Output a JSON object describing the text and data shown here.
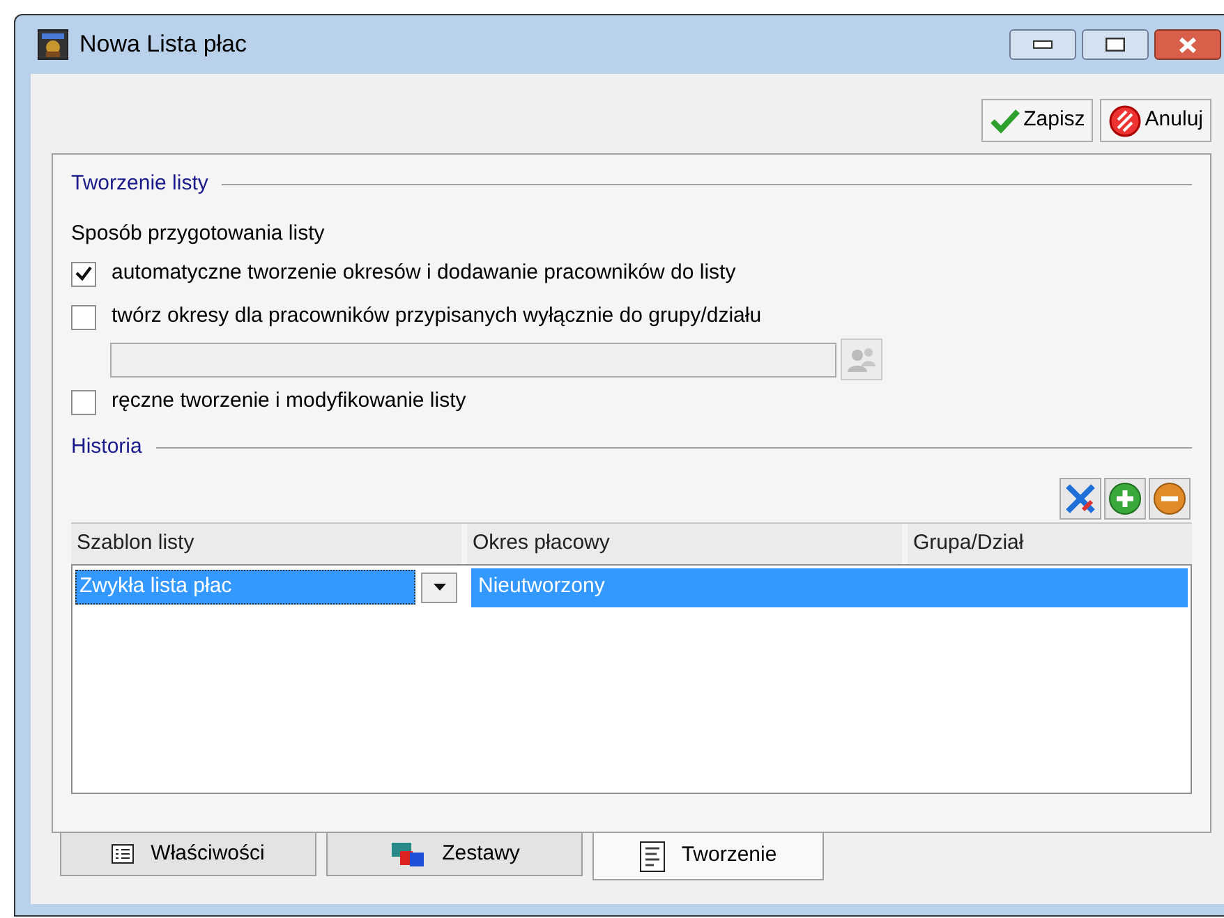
{
  "window": {
    "title": "Nowa Lista płac"
  },
  "toolbar": {
    "buttons": [
      {
        "kind": "save",
        "label": "Zapisz"
      },
      {
        "kind": "cancel",
        "label": "Anuluj"
      }
    ]
  },
  "creation": {
    "title": "Tworzenie listy",
    "subtitle": "Sposób przygotowania listy",
    "options": [
      {
        "kind": "checkbox",
        "label": "automatyczne tworzenie okresów i dodawanie pracowników do listy",
        "checked": true
      },
      {
        "kind": "checkbox",
        "label": "twórz okresy dla pracowników przypisanych wyłącznie do grupy/działu",
        "checked": false
      },
      {
        "kind": "group-field",
        "disabled": true
      },
      {
        "kind": "checkbox",
        "label": "ręczne tworzenie i modyfikowanie listy",
        "checked": false
      }
    ]
  },
  "history": {
    "title": "Historia",
    "columns": [
      "Szablon listy",
      "Okres płacowy",
      "Grupa/Dział"
    ],
    "rows": [
      {
        "template": "Zwykła lista płac",
        "period": "Nieutworzony",
        "group": "",
        "selected": true
      }
    ]
  },
  "tabs": [
    {
      "kind": "properties",
      "label": "Właściwości",
      "selected": false
    },
    {
      "kind": "sets",
      "label": "Zestawy",
      "selected": false
    },
    {
      "kind": "creation",
      "label": "Tworzenie",
      "selected": true
    }
  ]
}
